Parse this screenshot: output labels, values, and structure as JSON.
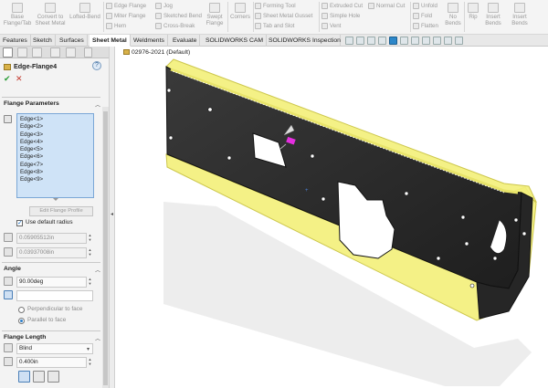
{
  "ribbon": {
    "base_flange": "Base\nFlange/Tab",
    "convert": "Convert to\nSheet Metal",
    "lofted_bend": "Lofted-Bend",
    "edge_flange": "Edge Flange",
    "miter_flange": "Miter Flange",
    "hem": "Hem",
    "jog": "Jog",
    "sketched_bend": "Sketched Bend",
    "cross_break": "Cross-Break",
    "swept_flange": "Swept\nFlange",
    "corners": "Corners",
    "forming_tool": "Forming Tool",
    "gusset": "Sheet Metal Gusset",
    "tab_slot": "Tab and Slot",
    "extruded_cut": "Extruded Cut",
    "simple_hole": "Simple Hole",
    "vent": "Vent",
    "normal_cut": "Normal Cut",
    "unfold": "Unfold",
    "fold": "Fold",
    "flatten": "Flatten",
    "no_bends": "No\nBends",
    "rip": "Rip",
    "insert_bends": "Insert\nBends",
    "insert_bends2": "Insert\nBends"
  },
  "tabs": [
    "Features",
    "Sketch",
    "Surfaces",
    "Sheet Metal",
    "Weldments",
    "Evaluate",
    "SOLIDWORKS CAM",
    "SOLIDWORKS Inspection"
  ],
  "active_tab": "Sheet Metal",
  "feature": {
    "title": "Edge-Flange4",
    "ok": "✔",
    "cancel": "✕"
  },
  "flange_params": {
    "title": "Flange Parameters",
    "edges": [
      "Edge<1>",
      "Edge<2>",
      "Edge<3>",
      "Edge<4>",
      "Edge<5>",
      "Edge<6>",
      "Edge<7>",
      "Edge<8>",
      "Edge<9>"
    ],
    "edit_profile": "Edit Flange Profile",
    "use_default_radius": "Use default radius",
    "radius": "0.05905512in",
    "gap": "0.03937008in"
  },
  "angle": {
    "title": "Angle",
    "value": "90.00deg",
    "face_value": "",
    "perpendicular": "Perpendicular to face",
    "parallel": "Parallel to face"
  },
  "flange_length": {
    "title": "Flange Length",
    "type": "Blind",
    "value": "0.400in"
  },
  "viewport": {
    "doc_title": "02976-2021  (Default)"
  },
  "colors": {
    "selection_highlight": "#f3f07a",
    "part_body": "#2c2c2c",
    "accent_blue": "#2d87c9"
  }
}
